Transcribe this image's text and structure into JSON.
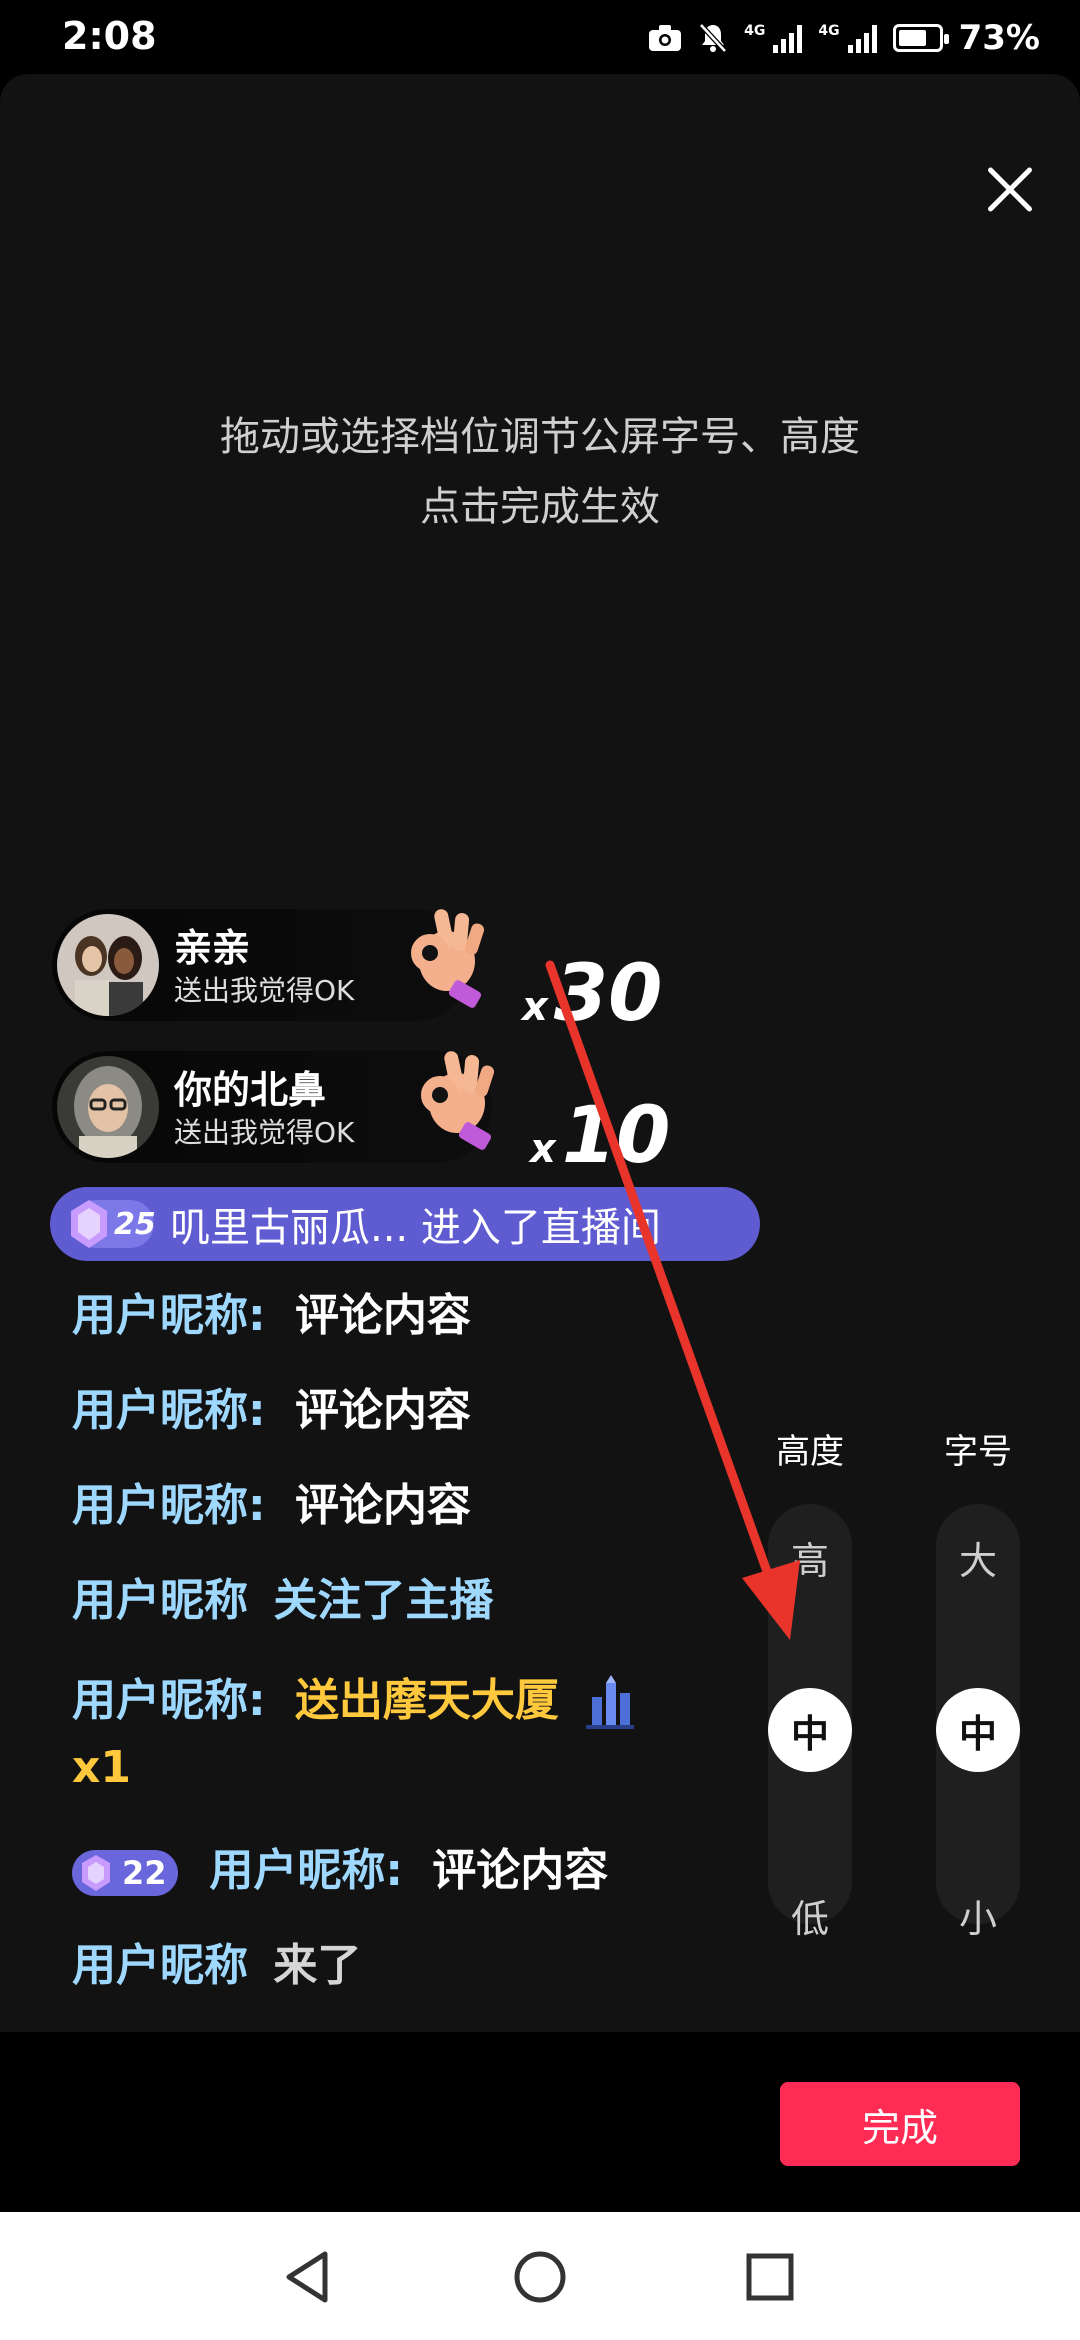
{
  "status_bar": {
    "time": "2:08",
    "network_1": "4G",
    "network_2": "4G",
    "battery_percent": "73%",
    "battery_level": 0.73
  },
  "hint": {
    "line1": "拖动或选择档位调节公屏字号、高度",
    "line2": "点击完成生效"
  },
  "gifts": [
    {
      "name": "亲亲",
      "sub": "送出我觉得OK",
      "x": "x",
      "count": "30"
    },
    {
      "name": "你的北鼻",
      "sub": "送出我觉得OK",
      "x": "x",
      "count": "10"
    }
  ],
  "entrance": {
    "level": "25",
    "text": "叽里古丽瓜... 进入了直播间"
  },
  "comments": [
    {
      "user": "用户昵称:",
      "text": "评论内容"
    },
    {
      "user": "用户昵称:",
      "text": "评论内容"
    },
    {
      "user": "用户昵称:",
      "text": "评论内容"
    },
    {
      "user": "用户昵称",
      "text": "关注了主播"
    },
    {
      "user": "用户昵称:",
      "text": "送出摩天大厦",
      "count": "x1"
    },
    {
      "level": "22",
      "user": "用户昵称:",
      "text": "评论内容"
    },
    {
      "user": "用户昵称",
      "text": "来了"
    }
  ],
  "sliders": {
    "height": {
      "label": "高度",
      "high": "高",
      "mid": "中",
      "low": "低",
      "selected": "中"
    },
    "font": {
      "label": "字号",
      "high": "大",
      "mid": "中",
      "low": "小",
      "selected": "中"
    }
  },
  "done_label": "完成",
  "colors": {
    "accent": "#fe2c55",
    "comment_user": "#9fd8ff",
    "gift_text": "#ffc83d",
    "banner": "#5f5bd0"
  }
}
